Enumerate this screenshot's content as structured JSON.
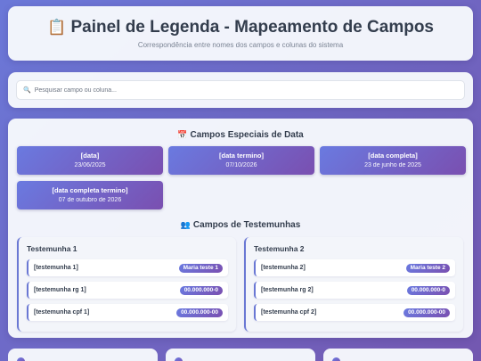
{
  "header": {
    "title_icon": "📋",
    "title": "Painel de Legenda - Mapeamento de Campos",
    "subtitle": "Correspondência entre nomes dos campos e colunas do sistema"
  },
  "search": {
    "icon": "🔍",
    "placeholder": "Pesquisar campo ou coluna..."
  },
  "date_section": {
    "icon": "📅",
    "title": "Campos Especiais de Data",
    "items": [
      {
        "label": "[data]",
        "value": "23/06/2025"
      },
      {
        "label": "[data termino]",
        "value": "07/10/2026"
      },
      {
        "label": "[data completa]",
        "value": "23 de junho de 2025"
      },
      {
        "label": "[data completa termino]",
        "value": "07 de outubro de 2026"
      }
    ]
  },
  "witness_section": {
    "icon": "👥",
    "title": "Campos de Testemunhas",
    "witnesses": [
      {
        "name": "Testemunha 1",
        "fields": [
          {
            "field": "[testemunha 1]",
            "value": "Maria teste 1"
          },
          {
            "field": "[testemunha rg 1]",
            "value": "00.000.000-0"
          },
          {
            "field": "[testemunha cpf 1]",
            "value": "00.000.000-00"
          }
        ]
      },
      {
        "name": "Testemunha 2",
        "fields": [
          {
            "field": "[testemunha 2]",
            "value": "Maria teste 2"
          },
          {
            "field": "[testemunha rg 2]",
            "value": "00.000.000-0"
          },
          {
            "field": "[testemunha cpf 2]",
            "value": "00.000.000-00"
          }
        ]
      }
    ]
  },
  "colors": {
    "accent_start": "#6a7ae0",
    "accent_end": "#7a4fb0",
    "text_dark": "#333d4d"
  }
}
